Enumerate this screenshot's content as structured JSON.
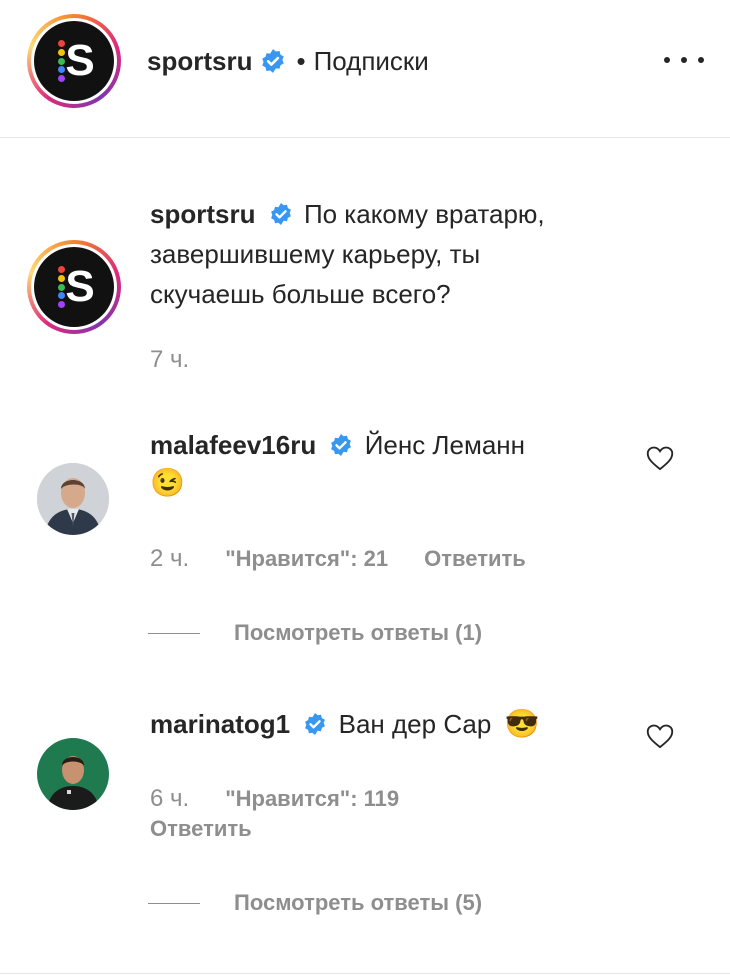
{
  "header": {
    "username": "sportsru",
    "separator": "•",
    "follow_label": "Подписки",
    "more_icon": "more-horizontal-icon"
  },
  "post": {
    "username": "sportsru",
    "caption_line1": "По какому вратарю,",
    "caption_line2": "завершившему карьеру, ты",
    "caption_line3": "скучаешь больше всего?",
    "time": "7 ч."
  },
  "comments": [
    {
      "username": "malafeev16ru",
      "text": "Йенс Леманн",
      "emoji": "😉",
      "time": "2 ч.",
      "likes": "\"Нравится\": 21",
      "reply_label": "Ответить",
      "view_replies": "Посмотреть ответы (1)"
    },
    {
      "username": "marinatog1",
      "text": "Ван дер Сар",
      "emoji": "😎",
      "time": "6 ч.",
      "likes": "\"Нравится\": 119",
      "reply_label": "Ответить",
      "view_replies": "Посмотреть ответы (5)"
    }
  ],
  "colors": {
    "verified": "#3897f0",
    "muted": "#8e8e8e",
    "text": "#262626",
    "logo_bg": "#111111"
  },
  "icons": [
    "verified-badge-icon",
    "heart-icon",
    "more-horizontal-icon"
  ]
}
